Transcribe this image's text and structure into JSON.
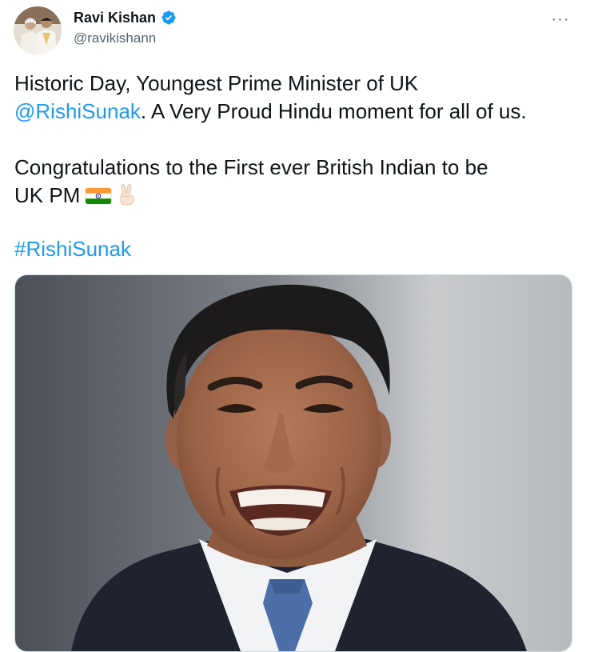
{
  "tweet": {
    "author": {
      "display_name": "Ravi Kishan",
      "handle": "@ravikishann",
      "verified": true,
      "avatar_icon": "avatar-photo"
    },
    "more_icon": "more-horizontal-icon",
    "more_label": "···",
    "text": {
      "line1": "Historic Day, Youngest Prime Minister of UK",
      "mention": "@RishiSunak",
      "line2_rest": ". A Very Proud Hindu moment for all of us.",
      "line3": "Congratulations to the First ever British Indian to be",
      "line4": "UK PM",
      "emojis": [
        "india-flag-emoji",
        "victory-hand-emoji"
      ],
      "hashtag": "#RishiSunak"
    },
    "media": {
      "type": "photo",
      "description_icon": "portrait-photo"
    },
    "colors": {
      "link": "#1d9bf0",
      "verified": "#1d9bf0",
      "secondary_text": "#536471"
    }
  }
}
